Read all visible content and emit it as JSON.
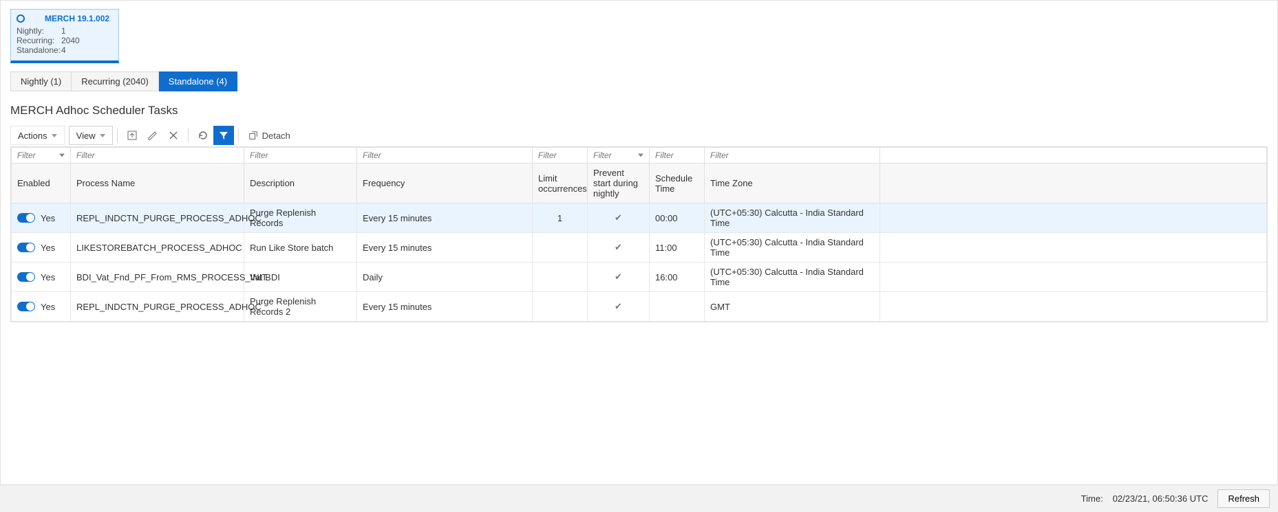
{
  "card": {
    "title": "MERCH 19.1.002",
    "stats": {
      "nightly_label": "Nightly:",
      "nightly_value": "1",
      "recurring_label": "Recurring:",
      "recurring_value": "2040",
      "standalone_label": "Standalone:",
      "standalone_value": "4"
    }
  },
  "tabs": {
    "nightly": "Nightly (1)",
    "recurring": "Recurring (2040)",
    "standalone": "Standalone (4)"
  },
  "section_title": "MERCH Adhoc Scheduler Tasks",
  "toolbar": {
    "actions": "Actions",
    "view": "View",
    "detach": "Detach"
  },
  "filter_placeholder": "Filter",
  "columns": {
    "enabled": "Enabled",
    "process": "Process Name",
    "description": "Description",
    "frequency": "Frequency",
    "limit": "Limit occurrences",
    "prevent": "Prevent start during nightly",
    "schedule": "Schedule Time",
    "timezone": "Time Zone"
  },
  "rows": [
    {
      "enabled": "Yes",
      "process": "REPL_INDCTN_PURGE_PROCESS_ADHOC",
      "description": "Purge Replenish Records",
      "frequency": "Every 15 minutes",
      "limit": "1",
      "prevent": true,
      "schedule": "00:00",
      "timezone": "(UTC+05:30) Calcutta - India Standard Time",
      "selected": true
    },
    {
      "enabled": "Yes",
      "process": "LIKESTOREBATCH_PROCESS_ADHOC",
      "description": "Run Like Store batch",
      "frequency": "Every 15 minutes",
      "limit": "",
      "prevent": true,
      "schedule": "11:00",
      "timezone": "(UTC+05:30) Calcutta - India Standard Time",
      "selected": false
    },
    {
      "enabled": "Yes",
      "process": "BDI_Vat_Fnd_PF_From_RMS_PROCESS_INIT",
      "description": "Vat BDI",
      "frequency": "Daily",
      "limit": "",
      "prevent": true,
      "schedule": "16:00",
      "timezone": "(UTC+05:30) Calcutta - India Standard Time",
      "selected": false
    },
    {
      "enabled": "Yes",
      "process": "REPL_INDCTN_PURGE_PROCESS_ADHOC",
      "description": "Purge Replenish Records 2",
      "frequency": "Every 15 minutes",
      "limit": "",
      "prevent": true,
      "schedule": "",
      "timezone": "GMT",
      "selected": false
    }
  ],
  "footer": {
    "time_label": "Time:",
    "time_value": "02/23/21, 06:50:36 UTC",
    "refresh": "Refresh"
  }
}
